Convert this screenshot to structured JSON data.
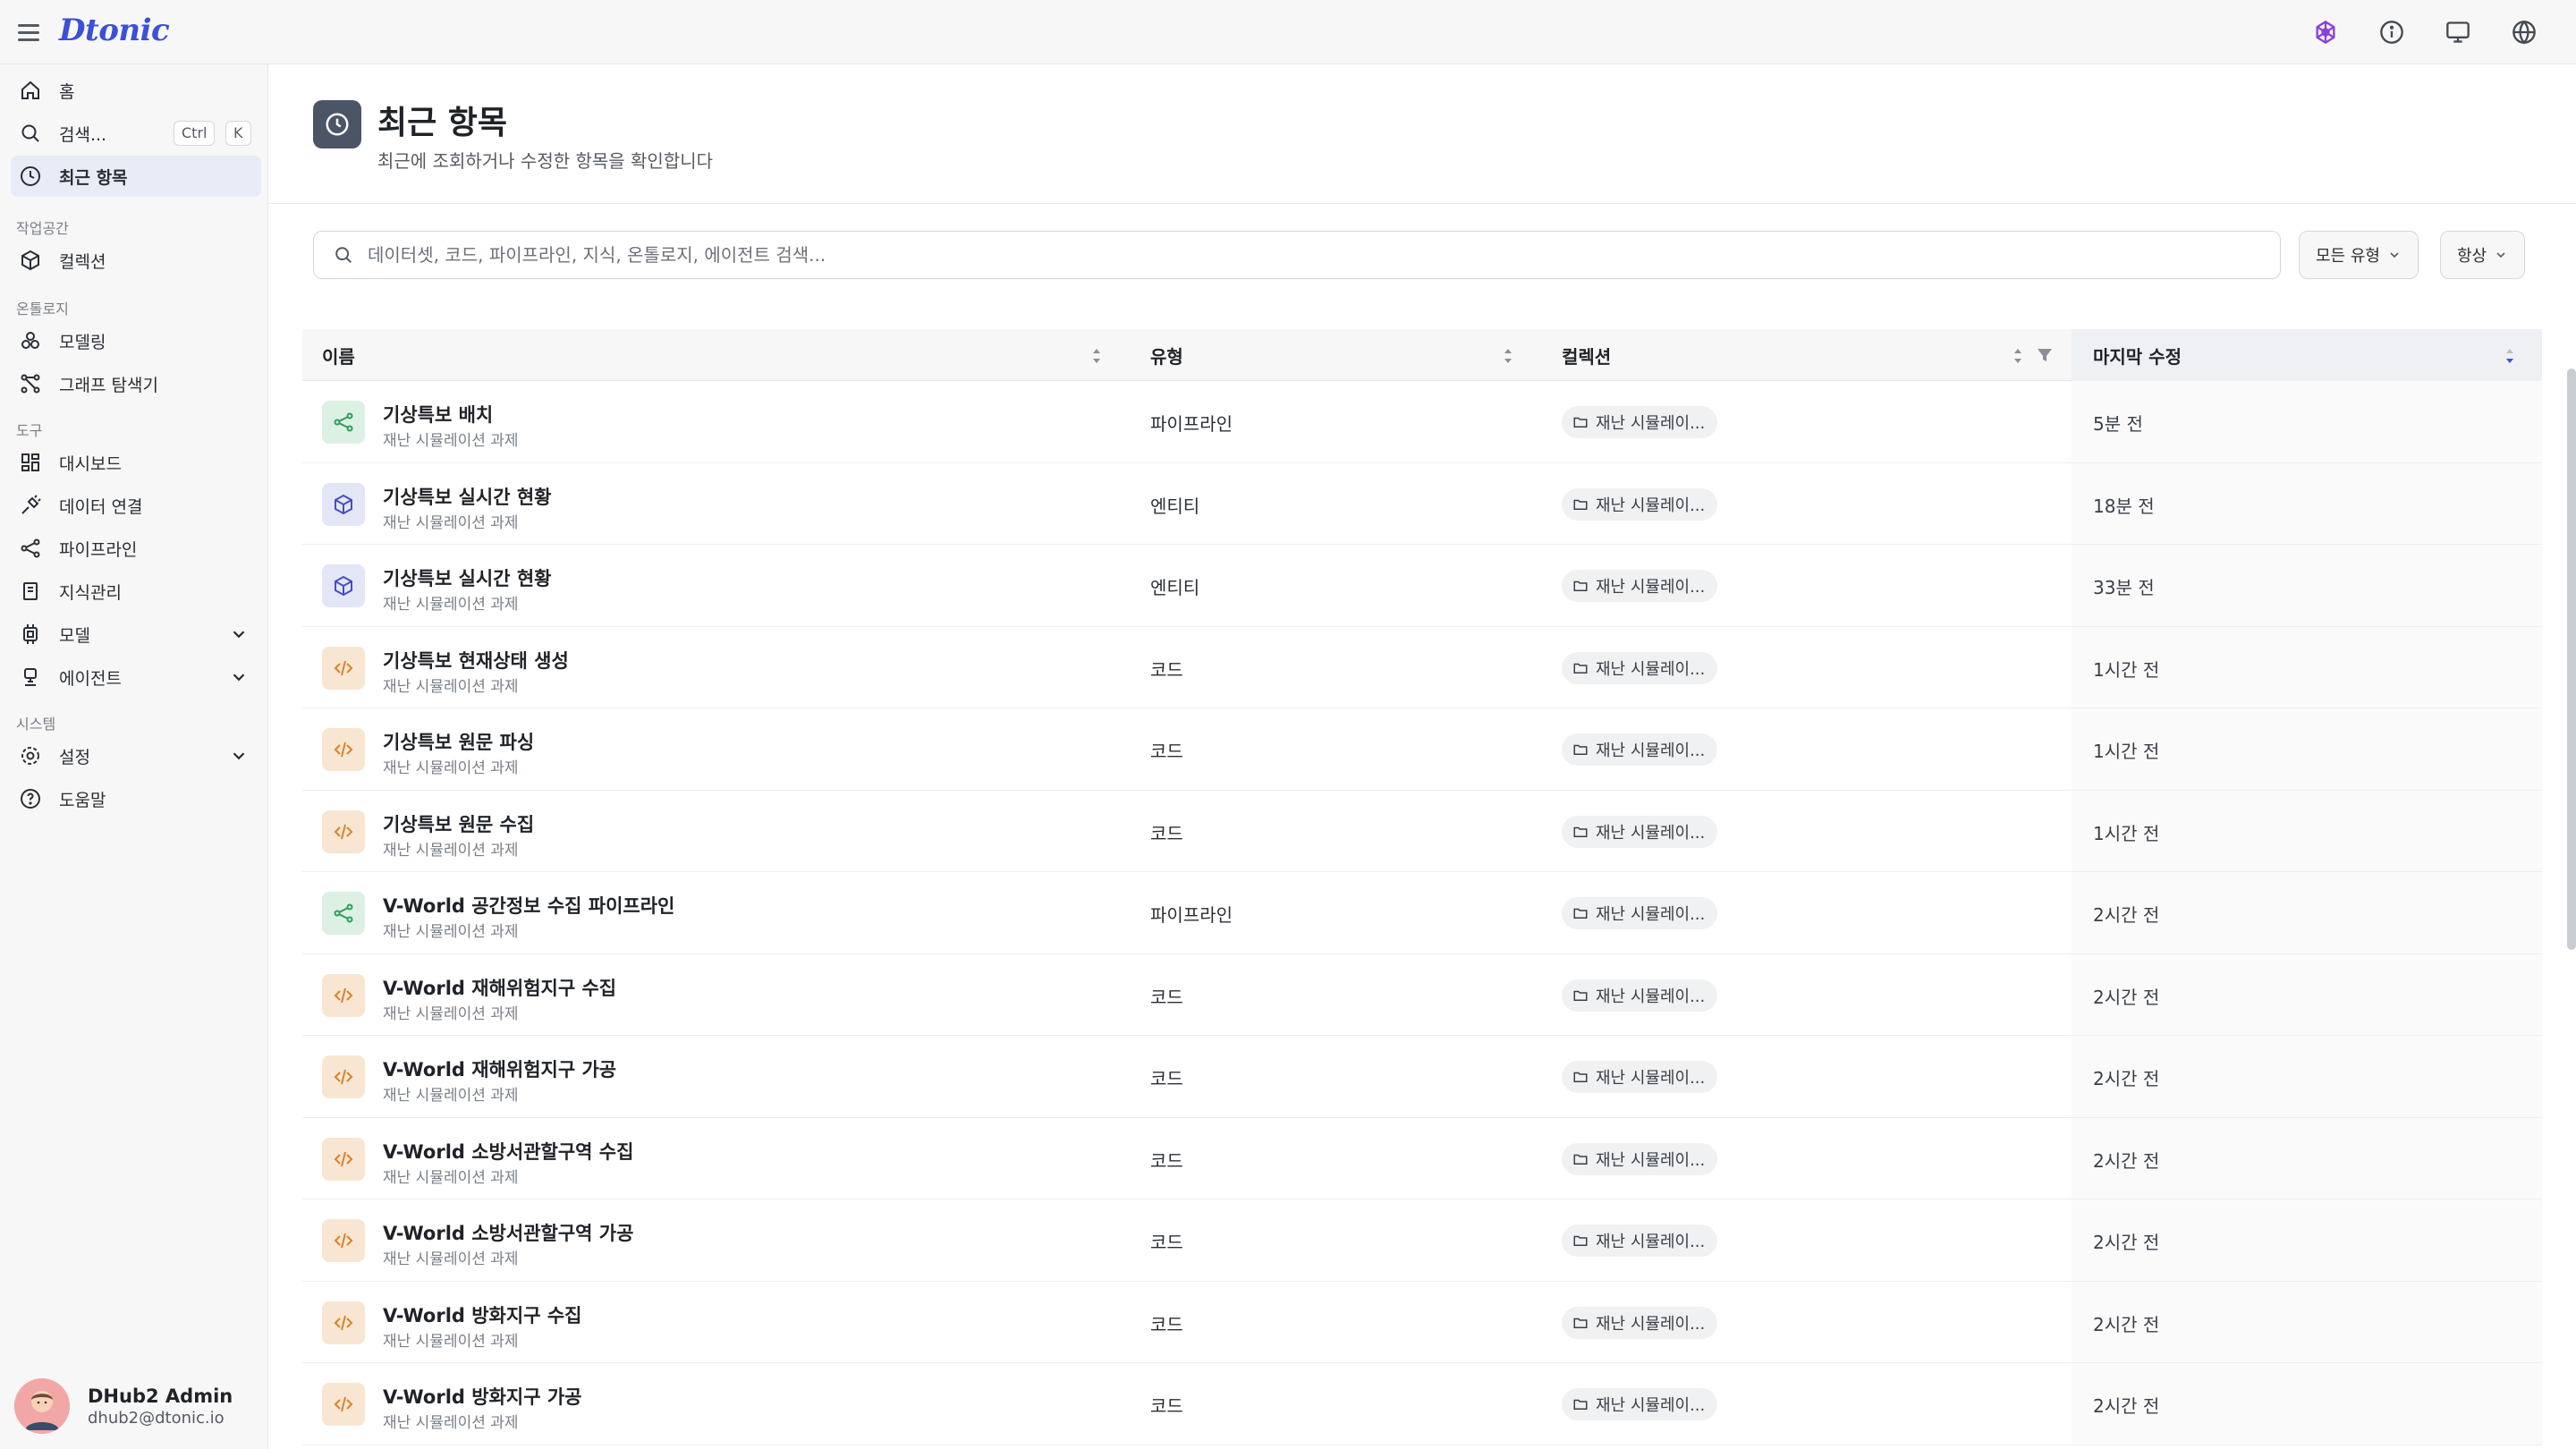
{
  "app": {
    "logo": "Dtonic"
  },
  "sidebar": {
    "home": "홈",
    "search": "검색...",
    "shortcut": [
      "Ctrl",
      "K"
    ],
    "recent": "최근 항목",
    "sections": {
      "workspace": "작업공간",
      "ontology": "온톨로지",
      "tools": "도구",
      "system": "시스템"
    },
    "collections": "컬렉션",
    "modeling": "모델링",
    "graph_explorer": "그래프 탐색기",
    "dashboard": "대시보드",
    "data_connection": "데이터 연결",
    "pipeline": "파이프라인",
    "knowledge": "지식관리",
    "model": "모델",
    "agent": "에이전트",
    "settings": "설정",
    "help": "도움말"
  },
  "user": {
    "name": "DHub2 Admin",
    "email": "dhub2@dtonic.io"
  },
  "page": {
    "title": "최근 항목",
    "subtitle": "최근에 조회하거나 수정한 항목을 확인합니다"
  },
  "search": {
    "placeholder": "데이터셋, 코드, 파이프라인, 지식, 온톨로지, 에이전트 검색..."
  },
  "filters": {
    "type": "모든 유형",
    "always": "항상"
  },
  "table": {
    "headers": {
      "name": "이름",
      "type": "유형",
      "collection": "컬렉션",
      "modified": "마지막 수정"
    },
    "rows": [
      {
        "kind": "pipeline",
        "name": "기상특보 배치",
        "sub": "재난 시뮬레이션 과제",
        "type": "파이프라인",
        "collection": "재난 시뮬레이...",
        "time": "5분 전"
      },
      {
        "kind": "entity",
        "name": "기상특보 실시간 현황",
        "sub": "재난 시뮬레이션 과제",
        "type": "엔티티",
        "collection": "재난 시뮬레이...",
        "time": "18분 전"
      },
      {
        "kind": "entity",
        "name": "기상특보 실시간 현황",
        "sub": "재난 시뮬레이션 과제",
        "type": "엔티티",
        "collection": "재난 시뮬레이...",
        "time": "33분 전"
      },
      {
        "kind": "code",
        "name": "기상특보 현재상태 생성",
        "sub": "재난 시뮬레이션 과제",
        "type": "코드",
        "collection": "재난 시뮬레이...",
        "time": "1시간 전"
      },
      {
        "kind": "code",
        "name": "기상특보 원문 파싱",
        "sub": "재난 시뮬레이션 과제",
        "type": "코드",
        "collection": "재난 시뮬레이...",
        "time": "1시간 전"
      },
      {
        "kind": "code",
        "name": "기상특보 원문 수집",
        "sub": "재난 시뮬레이션 과제",
        "type": "코드",
        "collection": "재난 시뮬레이...",
        "time": "1시간 전"
      },
      {
        "kind": "pipeline",
        "name": "V-World 공간정보 수집 파이프라인",
        "sub": "재난 시뮬레이션 과제",
        "type": "파이프라인",
        "collection": "재난 시뮬레이...",
        "time": "2시간 전"
      },
      {
        "kind": "code",
        "name": "V-World 재해위험지구 수집",
        "sub": "재난 시뮬레이션 과제",
        "type": "코드",
        "collection": "재난 시뮬레이...",
        "time": "2시간 전"
      },
      {
        "kind": "code",
        "name": "V-World 재해위험지구 가공",
        "sub": "재난 시뮬레이션 과제",
        "type": "코드",
        "collection": "재난 시뮬레이...",
        "time": "2시간 전"
      },
      {
        "kind": "code",
        "name": "V-World 소방서관할구역 수집",
        "sub": "재난 시뮬레이션 과제",
        "type": "코드",
        "collection": "재난 시뮬레이...",
        "time": "2시간 전"
      },
      {
        "kind": "code",
        "name": "V-World 소방서관할구역 가공",
        "sub": "재난 시뮬레이션 과제",
        "type": "코드",
        "collection": "재난 시뮬레이...",
        "time": "2시간 전"
      },
      {
        "kind": "code",
        "name": "V-World 방화지구 수집",
        "sub": "재난 시뮬레이션 과제",
        "type": "코드",
        "collection": "재난 시뮬레이...",
        "time": "2시간 전"
      },
      {
        "kind": "code",
        "name": "V-World 방화지구 가공",
        "sub": "재난 시뮬레이션 과제",
        "type": "코드",
        "collection": "재난 시뮬레이...",
        "time": "2시간 전"
      }
    ]
  },
  "colors": {
    "accent": "#3b4fd8",
    "pipeline_icon": "#2f9e5b",
    "entity_icon": "#4451b8",
    "code_icon": "#d9822b"
  }
}
